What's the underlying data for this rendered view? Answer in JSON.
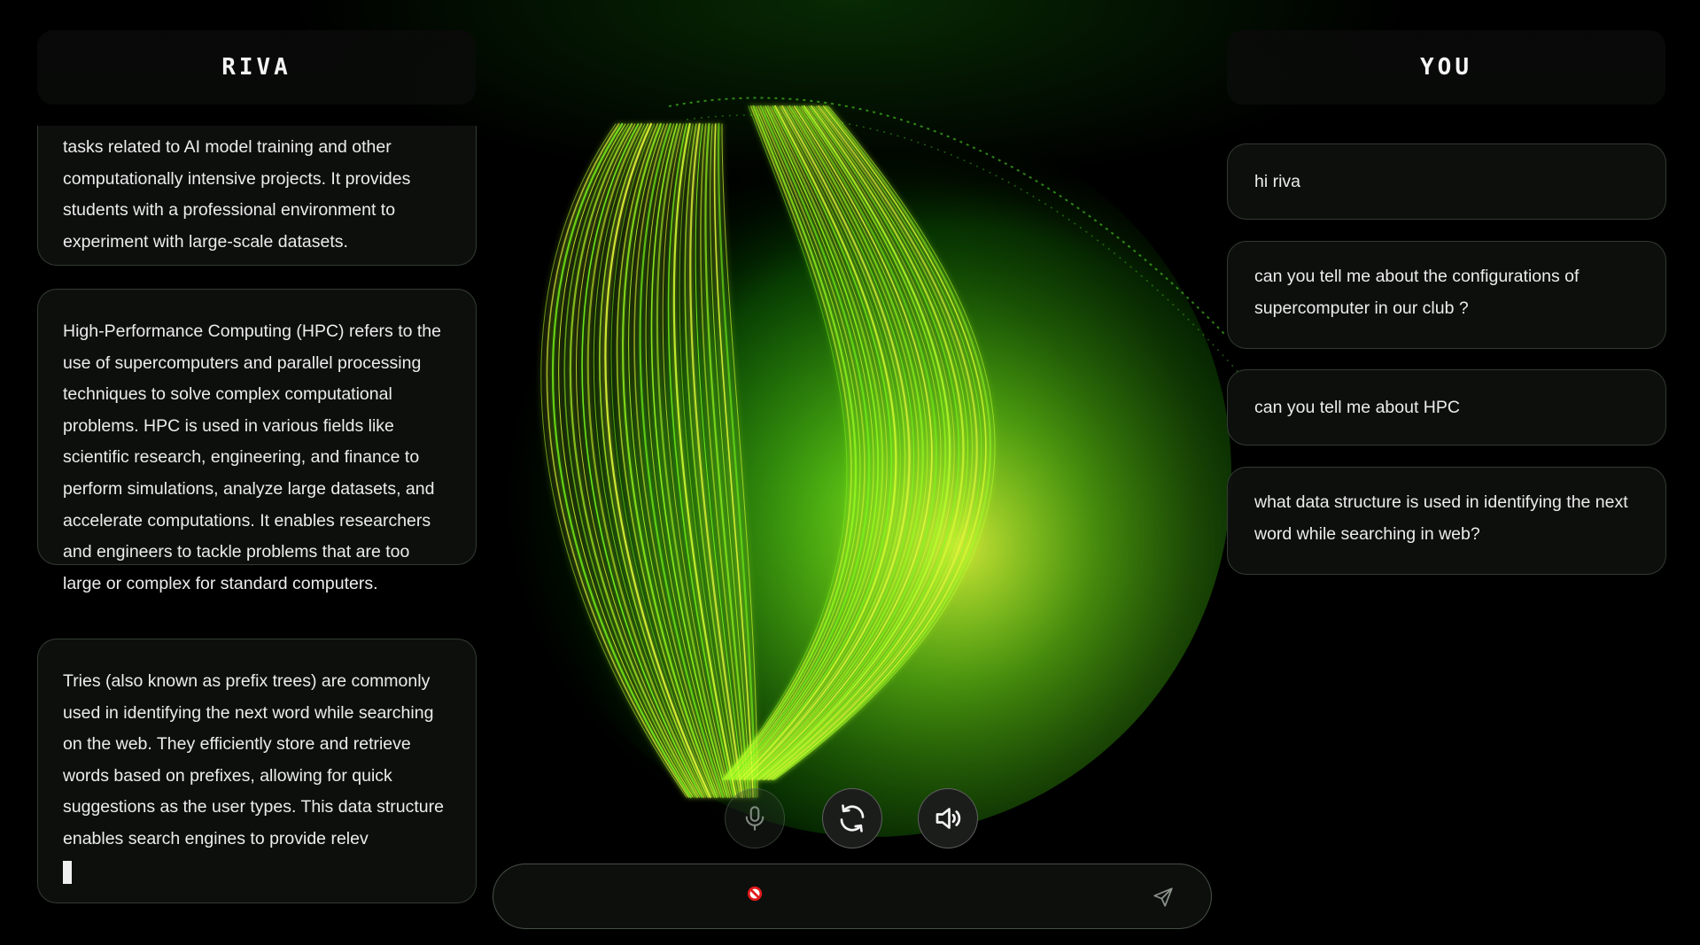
{
  "header": {
    "assistant_title": "RIVA",
    "user_title": "YOU"
  },
  "assistant_messages": [
    {
      "text": "tasks related to AI model training and other computationally intensive projects. It provides students with a professional environment to experiment with large-scale datasets."
    },
    {
      "text": "High-Performance Computing (HPC) refers to the use of supercomputers and parallel processing techniques to solve complex computational problems. HPC is used in various fields like scientific research, engineering, and finance to perform simulations, analyze large datasets, and accelerate computations. It enables researchers and engineers to tackle problems that are too large or complex for standard computers."
    },
    {
      "text": "Tries (also known as prefix trees) are commonly used in identifying the next word while searching on the web. They efficiently store and retrieve words based on prefixes, allowing for quick suggestions as the user types. This data structure enables search engines to provide relev"
    }
  ],
  "user_messages": [
    {
      "text": "hi riva"
    },
    {
      "text": "can you tell me about the configurations of supercomputer in our club ?"
    },
    {
      "text": "can you tell me about HPC"
    },
    {
      "text": "what data structure is used in identifying the next word while searching in web?"
    }
  ],
  "controls": {
    "mic_icon": "microphone-icon",
    "refresh_icon": "refresh-icon",
    "speaker_icon": "speaker-icon"
  },
  "input": {
    "value": "",
    "placeholder": "",
    "send_icon": "send-icon",
    "status_icon": "not-allowed-icon"
  },
  "colors": {
    "accent": "#39ff14",
    "glow_yellow": "#e8ff2a",
    "background": "#000000",
    "bubble_bg": "#0e100e"
  }
}
